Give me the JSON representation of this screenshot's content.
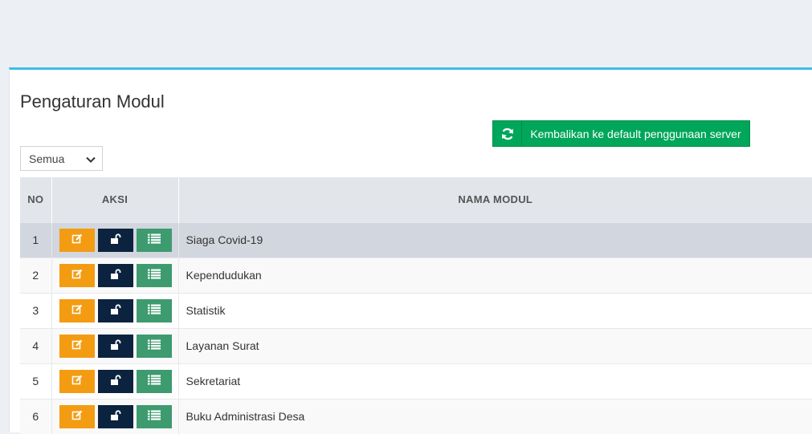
{
  "page": {
    "title": "Pengaturan Modul"
  },
  "toolbar": {
    "reset_label": "Kembalikan ke default penggunaan server",
    "reset_icon": "refresh-icon"
  },
  "filter": {
    "selected": "Semua"
  },
  "table": {
    "headers": {
      "no": "NO",
      "aksi": "AKSI",
      "name": "NAMA MODUL"
    },
    "rows": [
      {
        "no": "1",
        "name": "Siaga Covid-19"
      },
      {
        "no": "2",
        "name": "Kependudukan"
      },
      {
        "no": "3",
        "name": "Statistik"
      },
      {
        "no": "4",
        "name": "Layanan Surat"
      },
      {
        "no": "5",
        "name": "Sekretariat"
      },
      {
        "no": "6",
        "name": "Buku Administrasi Desa"
      }
    ]
  },
  "colors": {
    "accent": "#3cbde8",
    "success": "#00a65a",
    "edit": "#f39c12",
    "lock": "#0c2340",
    "list": "#3e9b6f"
  }
}
